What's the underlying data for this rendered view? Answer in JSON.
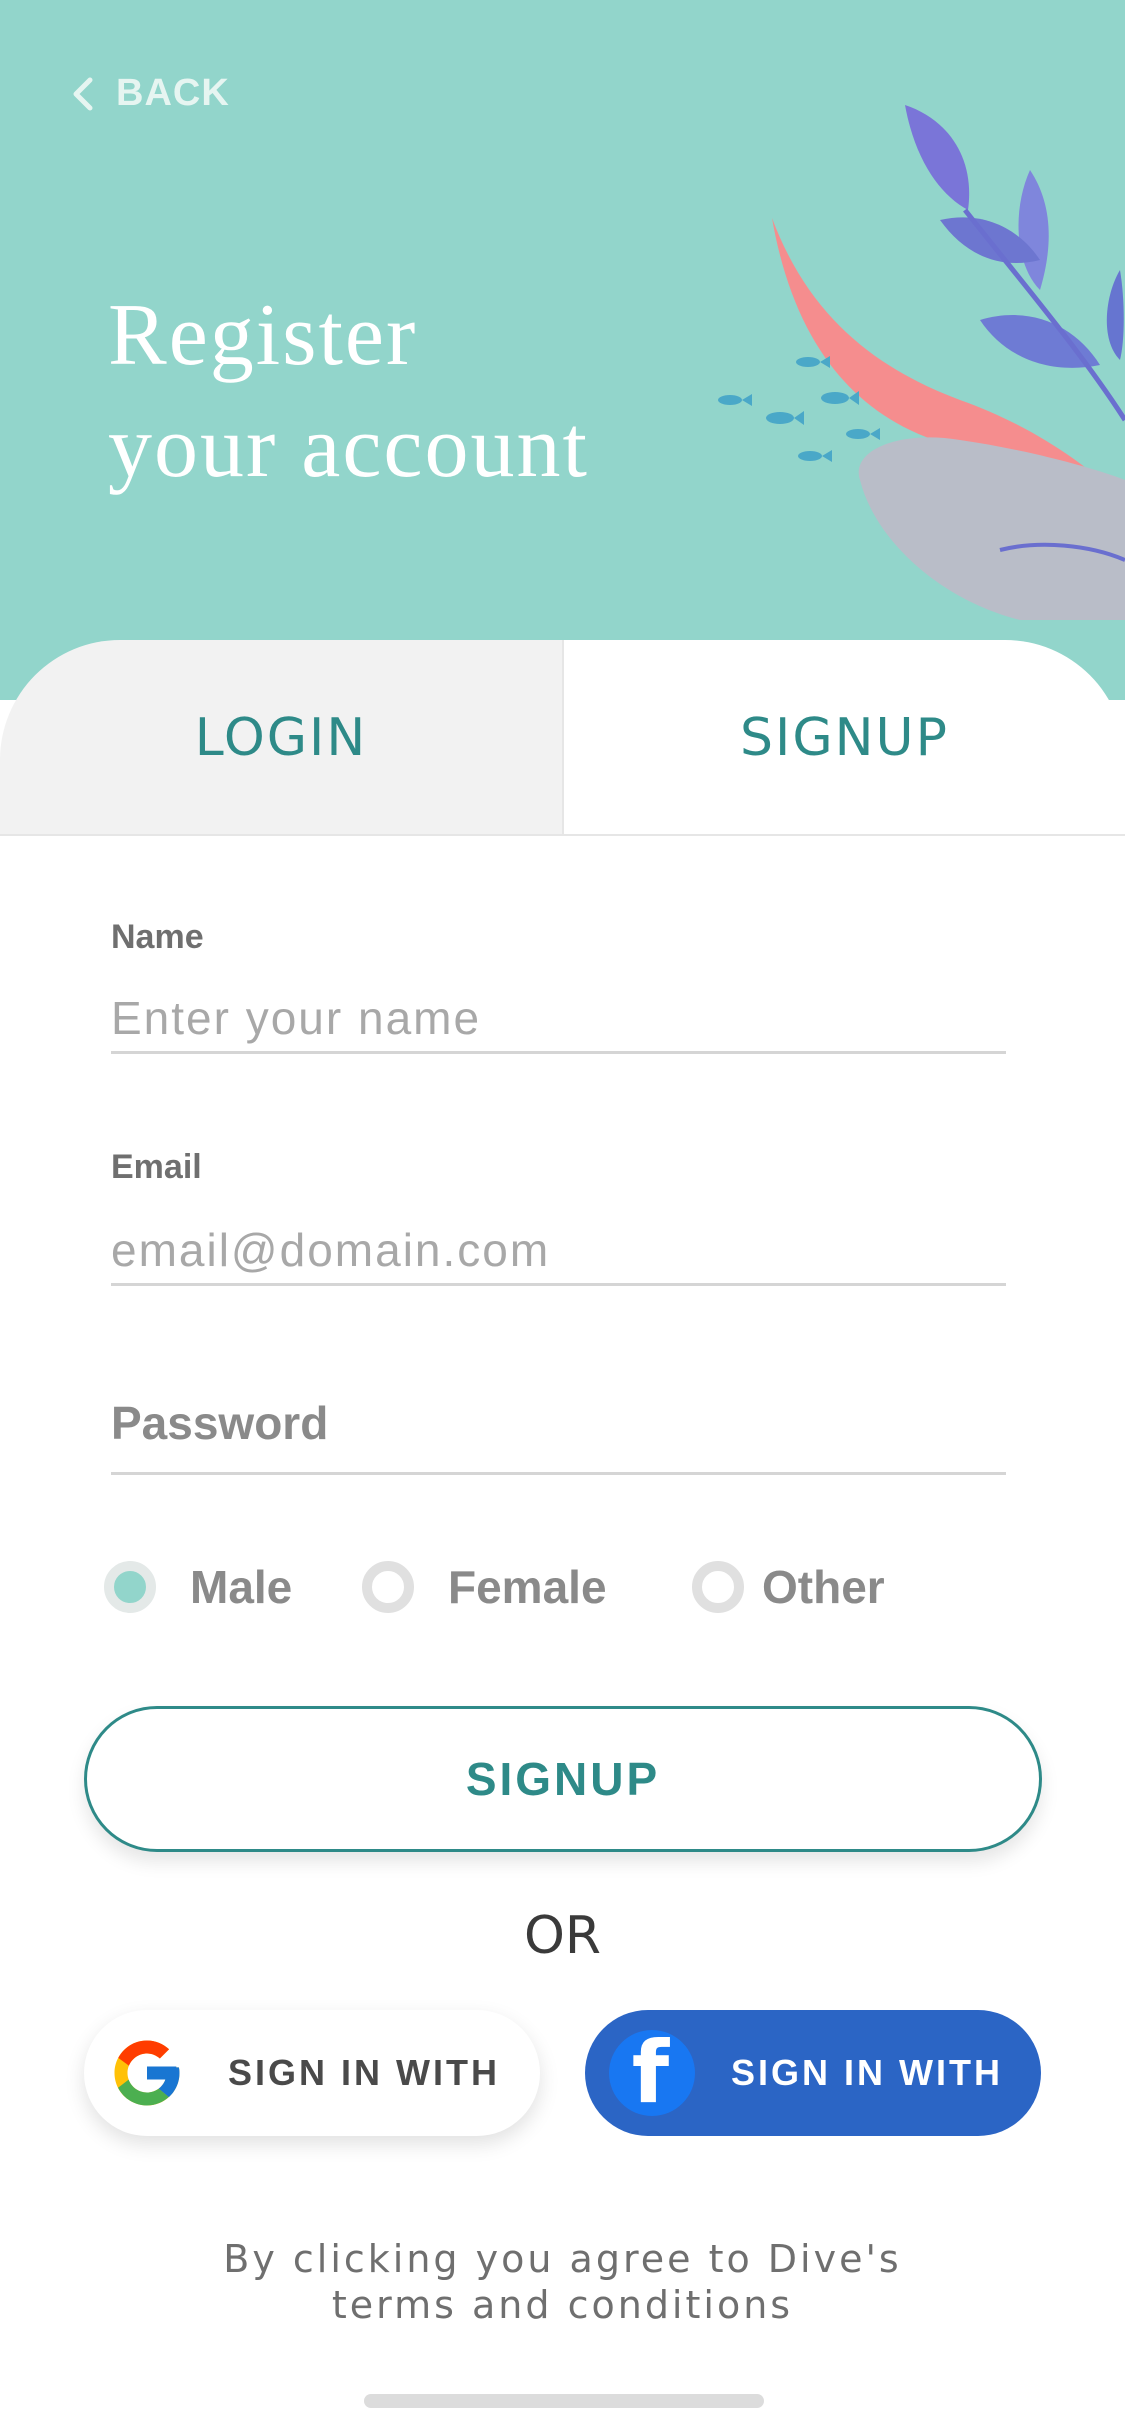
{
  "header": {
    "back_label": "BACK",
    "title_line1": "Register",
    "title_line2": "your account"
  },
  "tabs": {
    "login_label": "LOGIN",
    "signup_label": "SIGNUP",
    "active": "SIGNUP"
  },
  "form": {
    "name": {
      "label": "Name",
      "placeholder": "Enter your name",
      "value": ""
    },
    "email": {
      "label": "Email",
      "placeholder": "email@domain.com",
      "value": ""
    },
    "password": {
      "label": "Password",
      "value": ""
    },
    "gender": {
      "options": [
        "Male",
        "Female",
        "Other"
      ],
      "selected": "Male"
    },
    "submit_label": "SIGNUP"
  },
  "divider_label": "OR",
  "social": {
    "google_label": "SIGN IN WITH",
    "facebook_label": "SIGN IN WITH"
  },
  "terms": {
    "line1": "By clicking you agree to Dive's",
    "line2": "terms and conditions"
  },
  "colors": {
    "header_bg": "#92d5cb",
    "accent": "#2e8a88",
    "facebook": "#2b65c5"
  }
}
